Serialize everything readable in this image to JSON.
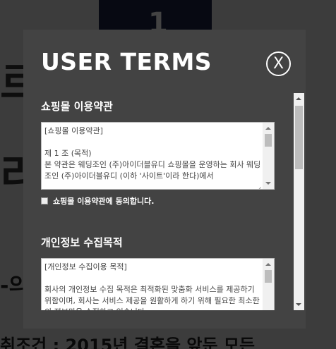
{
  "modal": {
    "title": "USER TERMS",
    "close_glyph": "X"
  },
  "sections": [
    {
      "title": "쇼핑몰 이용약관",
      "content": "[쇼핑몰 이용약관]\n\n제 1 조 (목적)\n본 약관은 웨딩조인 (주)아이더블유디 쇼핑몰을 운영하는 회사 웨딩조인 (주)아이더블유디 (이하 '사이트'이라 한다)에서",
      "agree_label": "쇼핑몰 이용약관에 동의합니다.",
      "agreed": false
    },
    {
      "title": "개인정보 수집목적",
      "content": "[개인정보 수집이용 목적]\n\n회사의 개인정보 수집 목적은 최적화된 맞춤화 서비스를 제공하기 위함이며, 회사는 서비스 제공을 원활하게 하기 위해 필요한 최소한의 정보만을 수집하고 있습니다."
    }
  ],
  "colors": {
    "modal_bg": "#434343",
    "overlay": "#000000",
    "text": "#ffffff"
  },
  "icons": {
    "close": "close-icon",
    "checkbox": "checkbox-icon",
    "scroll_up": "arrow-up-icon",
    "scroll_down": "arrow-down-icon"
  }
}
